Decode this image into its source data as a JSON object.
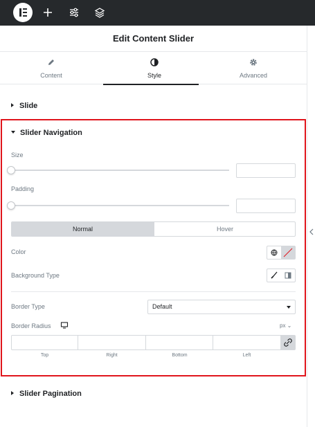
{
  "topbar": {
    "icons": [
      "elementor-logo-icon",
      "plus-icon",
      "sliders-icon",
      "layers-icon"
    ]
  },
  "header": {
    "title": "Edit Content Slider"
  },
  "tabs": [
    {
      "label": "Content",
      "icon": "pencil-icon"
    },
    {
      "label": "Style",
      "icon": "half-circle-icon",
      "active": true
    },
    {
      "label": "Advanced",
      "icon": "gear-icon"
    }
  ],
  "sections": {
    "slide": "Slide",
    "navigation": "Slider Navigation",
    "pagination": "Slider Pagination"
  },
  "navigation": {
    "size_label": "Size",
    "size_value": "",
    "padding_label": "Padding",
    "padding_value": "",
    "state_tabs": {
      "normal": "Normal",
      "hover": "Hover",
      "selected": "Normal"
    },
    "color_label": "Color",
    "background_type_label": "Background Type",
    "border_type_label": "Border Type",
    "border_type_value": "Default",
    "border_radius_label": "Border Radius",
    "units": "px ⌄",
    "dimensions": [
      "Top",
      "Right",
      "Bottom",
      "Left"
    ]
  },
  "colors": {
    "accent": "#e0141b",
    "topbar": "#26292c"
  }
}
